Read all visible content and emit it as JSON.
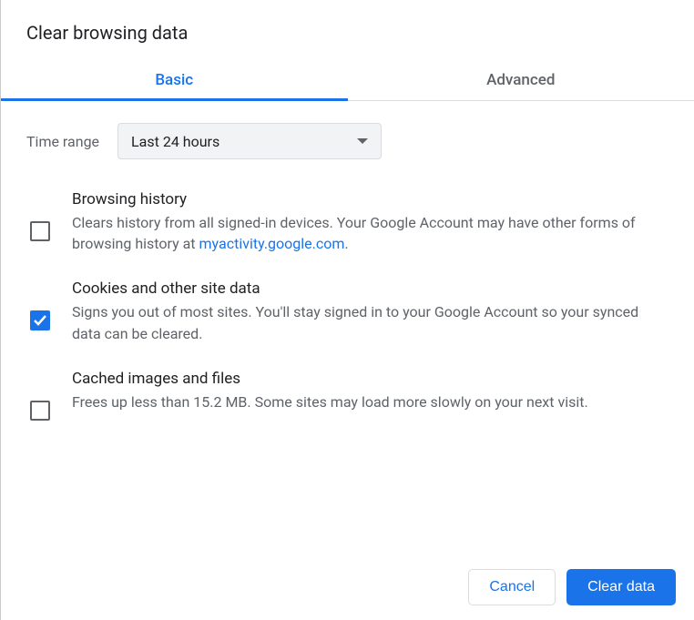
{
  "title": "Clear browsing data",
  "tabs": {
    "basic": "Basic",
    "advanced": "Advanced",
    "active": "basic"
  },
  "timeRange": {
    "label": "Time range",
    "selected": "Last 24 hours"
  },
  "options": [
    {
      "checked": false,
      "title": "Browsing history",
      "desc_prefix": "Clears history from all signed-in devices. Your Google Account may have other forms of browsing history at ",
      "link_text": "myactivity.google.com",
      "desc_suffix": "."
    },
    {
      "checked": true,
      "title": "Cookies and other site data",
      "desc": "Signs you out of most sites. You'll stay signed in to your Google Account so your synced data can be cleared."
    },
    {
      "checked": false,
      "title": "Cached images and files",
      "desc": "Frees up less than 15.2 MB. Some sites may load more slowly on your next visit."
    }
  ],
  "buttons": {
    "cancel": "Cancel",
    "clear": "Clear data"
  }
}
